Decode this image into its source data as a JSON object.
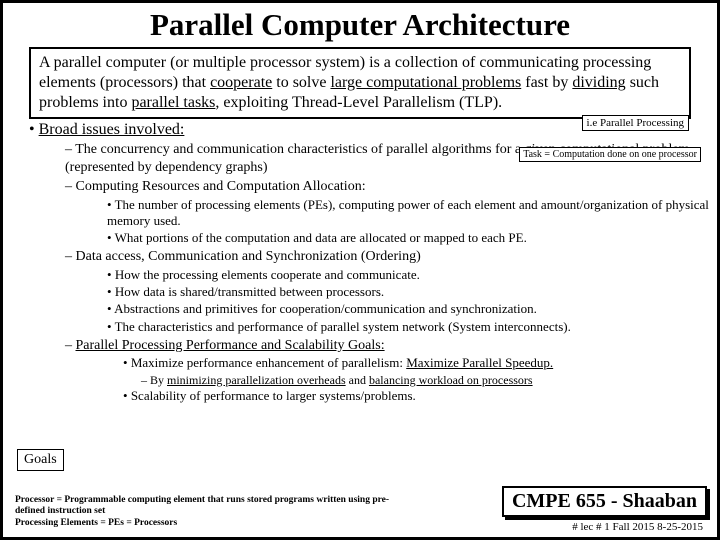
{
  "title": "Parallel Computer Architecture",
  "intro": {
    "line1a": "A parallel computer (or multiple processor system) is a collection of communicating processing elements (processors) that ",
    "u1": "cooperate",
    "line1b": " to solve ",
    "u2": "large computational problems",
    "line1c": " fast by ",
    "u3": "dividing",
    "line1d": " such problems into ",
    "u4": "parallel tasks",
    "line1e": ", exploiting Thread-Level Parallelism (TLP)."
  },
  "note1": "i.e Parallel Processing",
  "note2": "Task = Computation done on one processor",
  "broad_label": "Broad issues involved:",
  "items": {
    "i1": "The concurrency and communication characteristics of parallel algorithms for a given computational problem (represented by dependency graphs)",
    "i2": "Computing Resources and Computation Allocation:",
    "i2a": "The number of processing elements (PEs), computing power of each element and amount/organization of physical memory used.",
    "i2b": "What portions of the computation and  data are allocated or mapped to each PE.",
    "i3": "Data access, Communication and Synchronization (Ordering)",
    "i3a": "How the processing elements cooperate and communicate.",
    "i3b": "How data is shared/transmitted between processors.",
    "i3c": "Abstractions and primitives for cooperation/communication and synchronization.",
    "i3d": "The characteristics and performance of parallel system network (System interconnects).",
    "i4": "Parallel Processing Performance and Scalability Goals:",
    "i4a_pre": "Maximize performance enhancement of parallelism:  ",
    "i4a_u": "Maximize Parallel Speedup.",
    "i4a1_pre": "By ",
    "i4a1_u1": "minimizing parallelization overheads",
    "i4a1_mid": " and ",
    "i4a1_u2": "balancing workload on processors",
    "i4b": "Scalability of performance to larger systems/problems."
  },
  "goals_label": "Goals",
  "footnotes": {
    "f1a": "Processor =  Programmable computing element that runs stored programs written using pre-defined instruction set",
    "f2": "Processing Elements = PEs = Processors"
  },
  "course": "CMPE 655 - Shaaban",
  "lec": "#  lec # 1   Fall 2015   8-25-2015"
}
